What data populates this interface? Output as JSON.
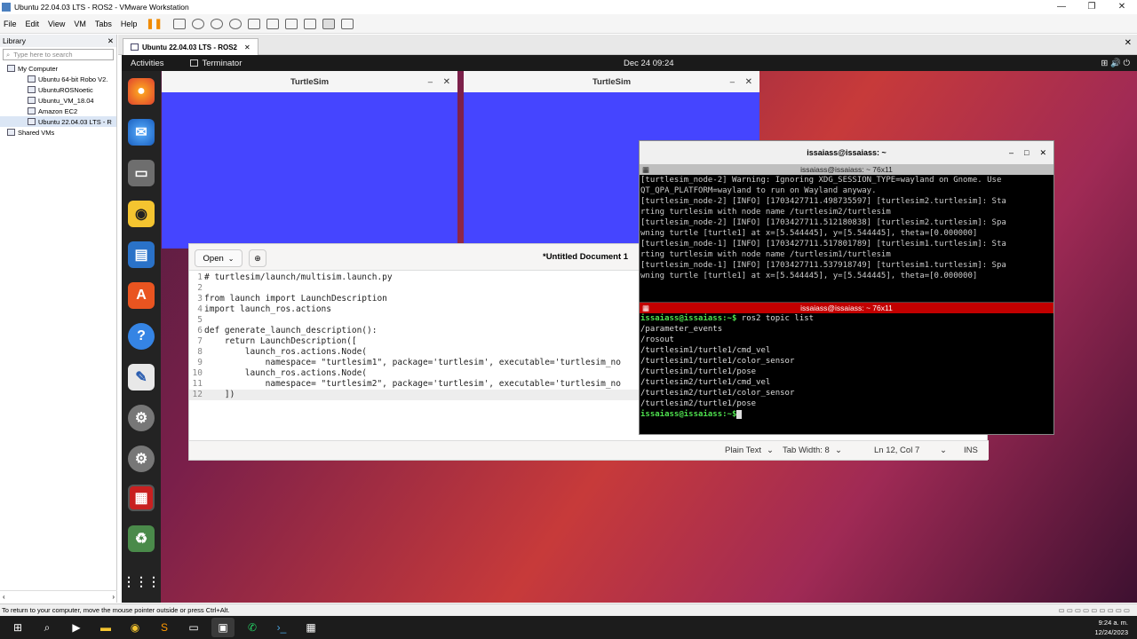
{
  "vmware": {
    "title": "Ubuntu 22.04.03 LTS - ROS2 - VMware Workstation",
    "menu": [
      "File",
      "Edit",
      "View",
      "VM",
      "Tabs",
      "Help"
    ],
    "library": {
      "title": "Library",
      "search_placeholder": "Type here to search",
      "tree": [
        {
          "label": "My Computer",
          "indent": 0
        },
        {
          "label": "Ubuntu 64-bit Robo V2.",
          "indent": 1
        },
        {
          "label": "UbuntuROSNoetic",
          "indent": 1
        },
        {
          "label": "Ubuntu_VM_18.04",
          "indent": 1
        },
        {
          "label": "Amazon EC2",
          "indent": 1
        },
        {
          "label": "Ubuntu 22.04.03 LTS - R",
          "indent": 1
        },
        {
          "label": "Shared VMs",
          "indent": 0
        }
      ]
    },
    "tab_label": "Ubuntu 22.04.03 LTS - ROS2",
    "status_text": "To return to your computer, move the mouse pointer outside or press Ctrl+Alt."
  },
  "guest": {
    "activities": "Activities",
    "app_name": "Terminator",
    "datetime": "Dec 24  09:24",
    "turtlesim_title": "TurtleSim",
    "editor": {
      "open_label": "Open",
      "title": "*Untitled Document 1",
      "lines": [
        "# turtlesim/launch/multisim.launch.py",
        "",
        "from launch import LaunchDescription",
        "import launch_ros.actions",
        "",
        "def generate_launch_description():",
        "    return LaunchDescription([",
        "        launch_ros.actions.Node(",
        "            namespace= \"turtlesim1\", package='turtlesim', executable='turtlesim_no",
        "        launch_ros.actions.Node(",
        "            namespace= \"turtlesim2\", package='turtlesim', executable='turtlesim_no",
        "    ])"
      ],
      "status_lang": "Plain Text",
      "status_tab": "Tab Width: 8",
      "status_pos": "Ln 12, Col 7",
      "status_mode": "INS"
    },
    "terminal": {
      "title": "issaiass@issaiass: ~",
      "pane_title": "issaiass@issaiass: ~ 76x11",
      "top_lines": [
        "[turtlesim_node-2] Warning: Ignoring XDG_SESSION_TYPE=wayland on Gnome. Use",
        "QT_QPA_PLATFORM=wayland to run on Wayland anyway.",
        "[turtlesim_node-2] [INFO] [1703427711.498735597] [turtlesim2.turtlesim]: Sta",
        "rting turtlesim with node name /turtlesim2/turtlesim",
        "[turtlesim_node-2] [INFO] [1703427711.512180838] [turtlesim2.turtlesim]: Spa",
        "wning turtle [turtle1] at x=[5.544445], y=[5.544445], theta=[0.000000]",
        "[turtlesim_node-1] [INFO] [1703427711.517801789] [turtlesim1.turtlesim]: Sta",
        "rting turtlesim with node name /turtlesim1/turtlesim",
        "[turtlesim_node-1] [INFO] [1703427711.537918749] [turtlesim1.turtlesim]: Spa",
        "wning turtle [turtle1] at x=[5.544445], y=[5.544445], theta=[0.000000]"
      ],
      "prompt": "issaiass@issaiass:~$",
      "command": " ros2 topic list",
      "bottom_lines": [
        "/parameter_events",
        "/rosout",
        "/turtlesim1/turtle1/cmd_vel",
        "/turtlesim1/turtle1/color_sensor",
        "/turtlesim1/turtle1/pose",
        "/turtlesim2/turtle1/cmd_vel",
        "/turtlesim2/turtle1/color_sensor",
        "/turtlesim2/turtle1/pose"
      ]
    }
  },
  "windows": {
    "clock_time": "9:24 a. m.",
    "clock_date": "12/24/2023"
  }
}
